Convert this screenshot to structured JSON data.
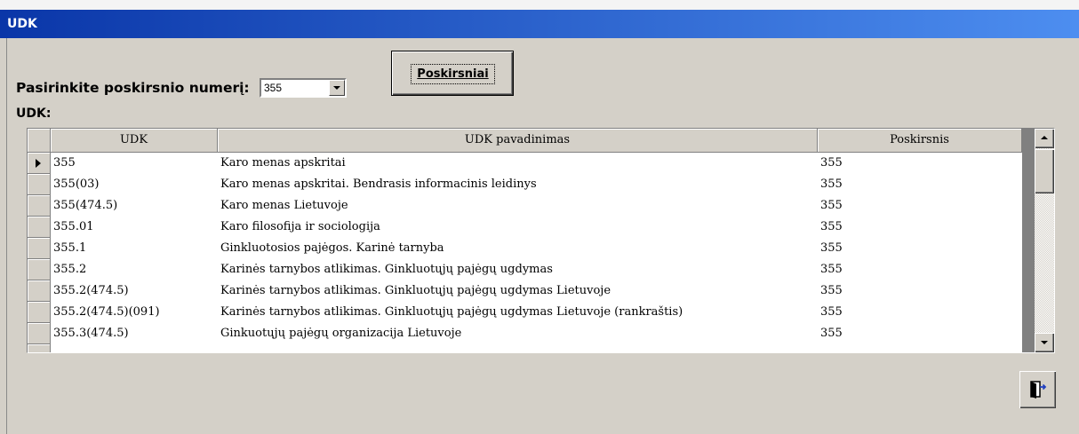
{
  "window": {
    "title": "UDK"
  },
  "filter": {
    "label": "Pasirinkite poskirsnio numerį:",
    "selected_value": "355"
  },
  "poskirsniai_button": {
    "label": "Poskirsniai"
  },
  "grid": {
    "label": "UDK:",
    "columns": [
      "UDK",
      "UDK pavadinimas",
      "Poskirsnis"
    ],
    "rows": [
      {
        "udk": "355",
        "pavadinimas": "Karo menas apskritai",
        "poskirsnis": "355"
      },
      {
        "udk": "355(03)",
        "pavadinimas": "Karo menas apskritai. Bendrasis informacinis leidinys",
        "poskirsnis": "355"
      },
      {
        "udk": "355(474.5)",
        "pavadinimas": "Karo menas Lietuvoje",
        "poskirsnis": "355"
      },
      {
        "udk": "355.01",
        "pavadinimas": "Karo filosofija ir sociologija",
        "poskirsnis": "355"
      },
      {
        "udk": "355.1",
        "pavadinimas": "Ginkluotosios pajėgos. Karinė tarnyba",
        "poskirsnis": "355"
      },
      {
        "udk": "355.2",
        "pavadinimas": "Karinės tarnybos atlikimas. Ginkluotųjų pajėgų ugdymas",
        "poskirsnis": "355"
      },
      {
        "udk": "355.2(474.5)",
        "pavadinimas": "Karinės tarnybos atlikimas. Ginkluotųjų pajėgų ugdymas Lietuvoje",
        "poskirsnis": "355"
      },
      {
        "udk": "355.2(474.5)(091)",
        "pavadinimas": "Karinės tarnybos atlikimas. Ginkluotųjų pajėgų ugdymas Lietuvoje (rankraštis)",
        "poskirsnis": "355"
      },
      {
        "udk": "355.3(474.5)",
        "pavadinimas": "Ginkuotųjų pajėgų organizacija Lietuvoje",
        "poskirsnis": "355"
      }
    ]
  },
  "icons": {
    "current_row": "current-row-arrow-icon",
    "dropdown": "chevron-down-icon",
    "scroll_up": "scroll-up-arrow-icon",
    "scroll_down": "scroll-down-arrow-icon",
    "exit": "exit-door-icon"
  },
  "colors": {
    "title_bar_start": "#0a36a8",
    "title_bar_end": "#4d8ef0",
    "window_bg": "#d4d0c8"
  }
}
